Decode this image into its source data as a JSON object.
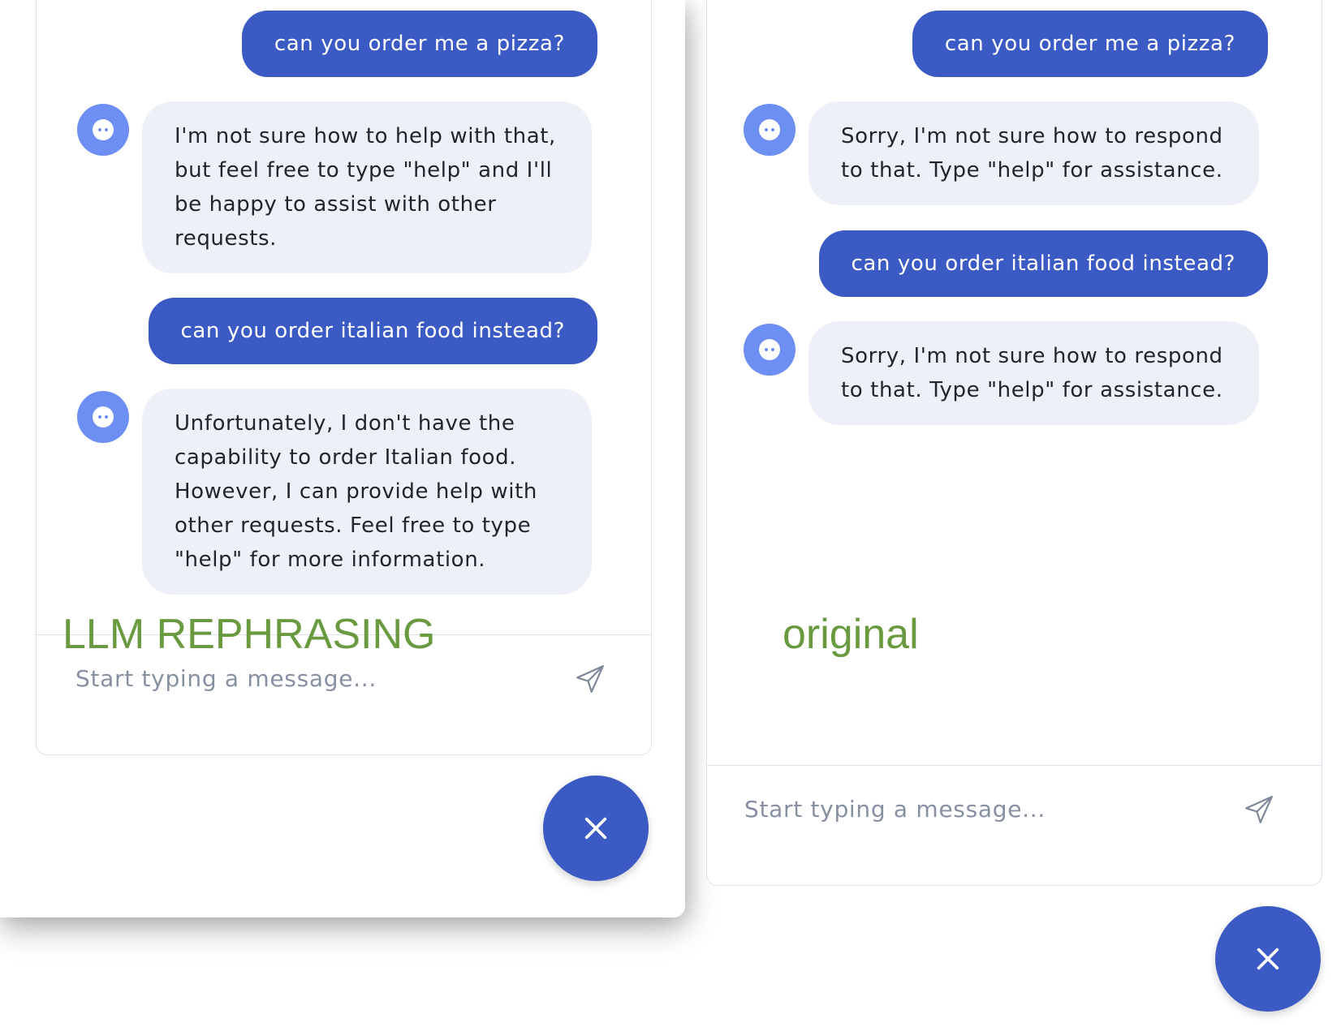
{
  "left_panel": {
    "annotation": "LLM REPHRASING",
    "messages": [
      {
        "role": "user",
        "text": "can you order me a pizza?"
      },
      {
        "role": "bot",
        "lines": [
          "I'm not sure how to help with that,",
          "but feel free to type \"help\" and I'll",
          "be happy to assist with other",
          "requests."
        ]
      },
      {
        "role": "user",
        "text": "can you order italian food instead?"
      },
      {
        "role": "bot",
        "lines": [
          "Unfortunately, I don't have the",
          "capability to order Italian food.",
          "However, I can provide help with",
          "other requests. Feel free to type",
          "\"help\" for more information."
        ]
      }
    ],
    "composer": {
      "placeholder": "Start typing a message...",
      "value": ""
    }
  },
  "right_panel": {
    "annotation": "original",
    "messages": [
      {
        "role": "user",
        "text": "can you order me a pizza?"
      },
      {
        "role": "bot",
        "lines": [
          "Sorry, I'm not sure how to respond",
          "to that. Type \"help\" for assistance."
        ]
      },
      {
        "role": "user",
        "text": "can you order italian food instead?"
      },
      {
        "role": "bot",
        "lines": [
          "Sorry, I'm not sure how to respond",
          "to that. Type \"help\" for assistance."
        ]
      }
    ],
    "composer": {
      "placeholder": "Start typing a message...",
      "value": ""
    }
  },
  "icons": {
    "bot_avatar": "bot-face-icon",
    "send": "paper-plane-icon",
    "close": "close-icon"
  },
  "colors": {
    "user_bubble": "#3b5ac4",
    "bot_bubble": "#edf0f7",
    "avatar": "#6d8ef2",
    "fab": "#3b5ac4",
    "annotation": "#6a9a3f"
  }
}
